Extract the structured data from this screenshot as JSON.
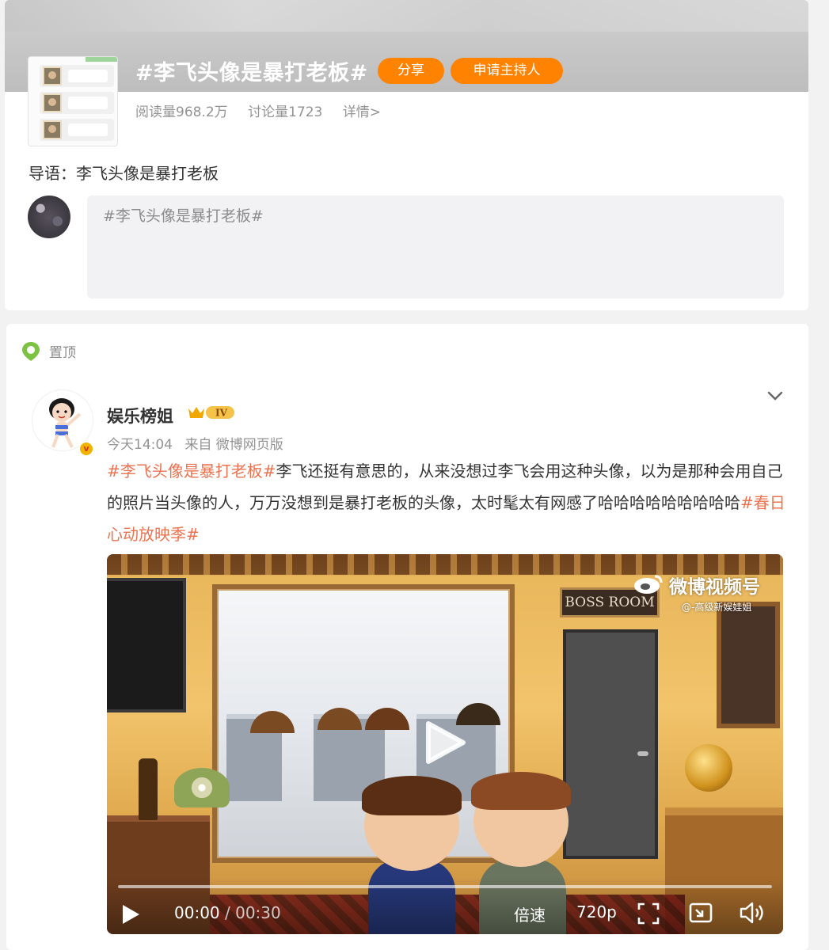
{
  "topic": {
    "title": "#李飞头像是暴打老板#",
    "share_label": "分享",
    "host_label": "申请主持人",
    "reads": "阅读量968.2万",
    "discussions": "讨论量1723",
    "detail_link": "详情>",
    "intro": "导语：李飞头像是暴打老板",
    "post_input_value": "#李飞头像是暴打老板#"
  },
  "feed": {
    "pin_label": "置顶",
    "user_name": "娱乐榜姐",
    "level_badge": "IV",
    "verify_mark": "v",
    "time": "今天14:04",
    "source": "来自 微博网页版",
    "post": {
      "tag1": "#李飞头像是暴打老板#",
      "text": "李飞还挺有意思的，从来没想过李飞会用这种头像，以为是那种会用自己的照片当头像的人，万万没想到是暴打老板的头像，太时髦太有网感了哈哈哈哈哈哈哈哈哈",
      "tag2": "#春日心动放映季#"
    }
  },
  "video": {
    "watermark": "微博视频号",
    "watermark_sub": "@-高级新娱娃姐",
    "sign_text": "BOSS ROOM",
    "time_current": "00:00",
    "time_separator": "/",
    "time_total": "00:30",
    "progress": 0,
    "speed_label": "倍速",
    "quality_label": "720p"
  },
  "colors": {
    "accent_orange": "#ff8200",
    "tag_color": "#eb7350"
  }
}
